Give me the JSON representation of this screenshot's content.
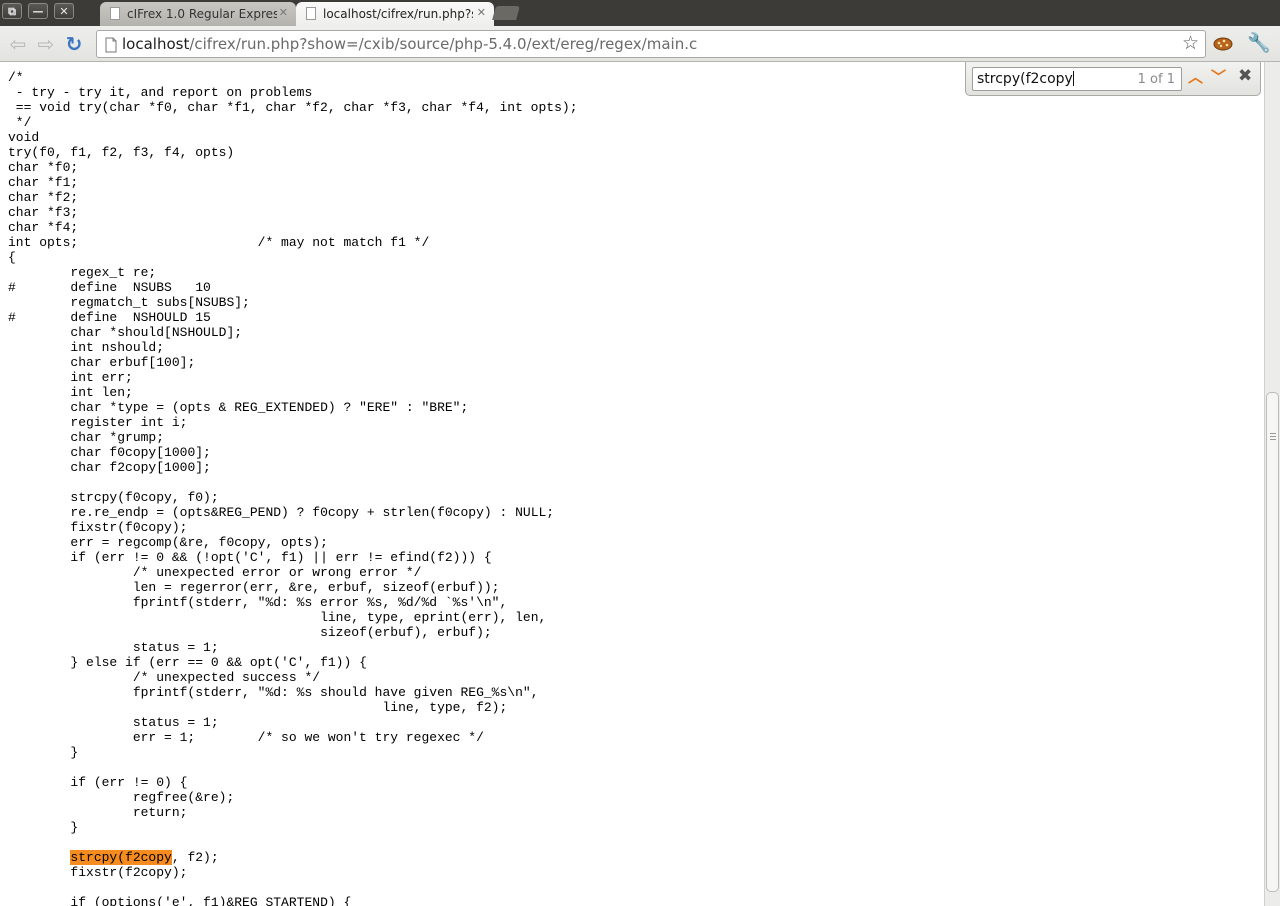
{
  "window": {
    "restore_glyph": "⧉",
    "minimize_glyph": "—",
    "close_glyph": "✕"
  },
  "tabs": [
    {
      "title": "cIFrex 1.0 Regular Express",
      "close_glyph": "✕"
    },
    {
      "title": "localhost/cifrex/run.php?s",
      "close_glyph": "✕"
    }
  ],
  "toolbar": {
    "back_glyph": "⇦",
    "forward_glyph": "⇨",
    "reload_glyph": "↻",
    "url_host": "localhost",
    "url_path": "/cifrex/run.php?show=/cxib/source/php-5.4.0/ext/ereg/regex/main.c",
    "star_glyph": "☆",
    "wrench_glyph": "🔧",
    "icons": [
      "page-icon",
      "star-icon",
      "extension-icon",
      "wrench-icon"
    ]
  },
  "find": {
    "query": "strcpy(f2copy",
    "count": "1 of 1",
    "prev_glyph": "︿",
    "next_glyph": "﹀",
    "close_glyph": "✖",
    "highlight_color": "#f68b1f"
  },
  "code": {
    "before": "/*\n - try - try it, and report on problems\n == void try(char *f0, char *f1, char *f2, char *f3, char *f4, int opts);\n */\nvoid\ntry(f0, f1, f2, f3, f4, opts)\nchar *f0;\nchar *f1;\nchar *f2;\nchar *f3;\nchar *f4;\nint opts;\t\t\t/* may not match f1 */\n{\n\tregex_t re;\n#\tdefine\tNSUBS\t10\n\tregmatch_t subs[NSUBS];\n#\tdefine\tNSHOULD\t15\n\tchar *should[NSHOULD];\n\tint nshould;\n\tchar erbuf[100];\n\tint err;\n\tint len;\n\tchar *type = (opts & REG_EXTENDED) ? \"ERE\" : \"BRE\";\n\tregister int i;\n\tchar *grump;\n\tchar f0copy[1000];\n\tchar f2copy[1000];\n\n\tstrcpy(f0copy, f0);\n\tre.re_endp = (opts&REG_PEND) ? f0copy + strlen(f0copy) : NULL;\n\tfixstr(f0copy);\n\terr = regcomp(&re, f0copy, opts);\n\tif (err != 0 && (!opt('C', f1) || err != efind(f2))) {\n\t\t/* unexpected error or wrong error */\n\t\tlen = regerror(err, &re, erbuf, sizeof(erbuf));\n\t\tfprintf(stderr, \"%d: %s error %s, %d/%d `%s'\\n\",\n\t\t\t\t\tline, type, eprint(err), len,\n\t\t\t\t\tsizeof(erbuf), erbuf);\n\t\tstatus = 1;\n\t} else if (err == 0 && opt('C', f1)) {\n\t\t/* unexpected success */\n\t\tfprintf(stderr, \"%d: %s should have given REG_%s\\n\",\n\t\t\t\t\t\tline, type, f2);\n\t\tstatus = 1;\n\t\terr = 1;\t/* so we won't try regexec */\n\t}\n\n\tif (err != 0) {\n\t\tregfree(&re);\n\t\treturn;\n\t}\n\n\t",
    "match": "strcpy(f2copy",
    "after": ", f2);\n\tfixstr(f2copy);\n\n\tif (options('e', f1)&REG_STARTEND) {"
  }
}
